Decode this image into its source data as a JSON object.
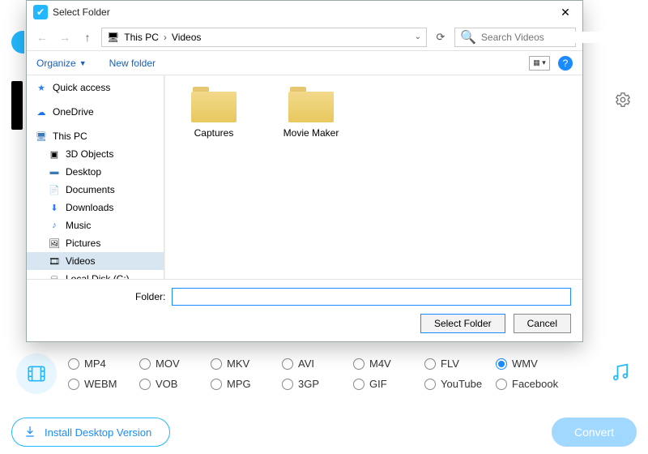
{
  "dialog": {
    "title": "Select Folder",
    "breadcrumb": {
      "root": "This PC",
      "current": "Videos"
    },
    "search_placeholder": "Search Videos",
    "toolbar": {
      "organize": "Organize",
      "new_folder": "New folder"
    },
    "tree": {
      "quick_access": "Quick access",
      "onedrive": "OneDrive",
      "this_pc": "This PC",
      "objects3d": "3D Objects",
      "desktop": "Desktop",
      "documents": "Documents",
      "downloads": "Downloads",
      "music": "Music",
      "pictures": "Pictures",
      "videos": "Videos",
      "local_disk": "Local Disk (C:)"
    },
    "folders": [
      "Captures",
      "Movie Maker"
    ],
    "footer": {
      "label": "Folder:",
      "value": "",
      "select": "Select Folder",
      "cancel": "Cancel"
    }
  },
  "app": {
    "formats": [
      "MP4",
      "MOV",
      "MKV",
      "AVI",
      "M4V",
      "FLV",
      "WMV",
      "WEBM",
      "VOB",
      "MPG",
      "3GP",
      "GIF",
      "YouTube",
      "Facebook"
    ],
    "selected_format": "WMV",
    "install": "Install Desktop Version",
    "convert": "Convert"
  }
}
